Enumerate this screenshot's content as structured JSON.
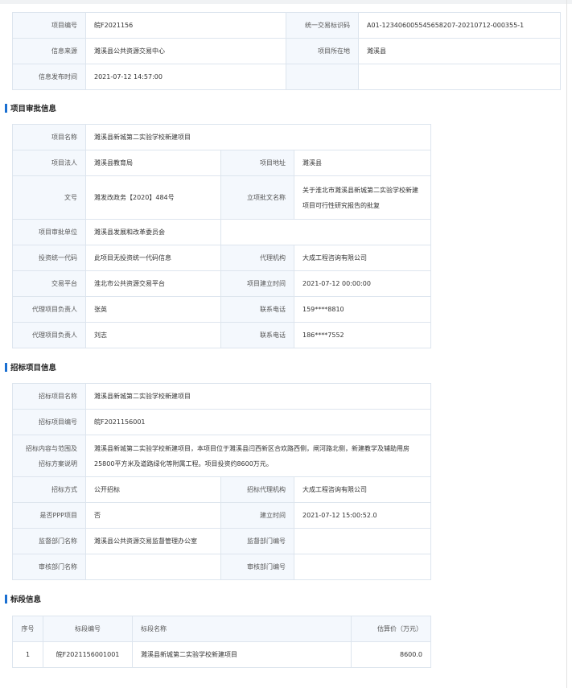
{
  "top_info": {
    "project_no_label": "项目编号",
    "project_no": "皖F2021156",
    "unified_code_label": "统一交易标识码",
    "unified_code": "A01-123406005545658207-20210712-000355-1",
    "source_label": "信息来源",
    "source": "濉溪县公共资源交易中心",
    "location_label": "项目所在地",
    "location": "濉溪县",
    "publish_time_label": "信息发布时间",
    "publish_time": "2021-07-12 14:57:00"
  },
  "approval": {
    "title": "项目审批信息",
    "name_label": "项目名称",
    "name": "濉溪县新城第二实验学校新建项目",
    "legal_label": "项目法人",
    "legal": "濉溪县教育局",
    "address_label": "项目地址",
    "address": "濉溪县",
    "doc_no_label": "文号",
    "doc_no": "濉发改政务【2020】484号",
    "doc_name_label": "立项批文名称",
    "doc_name": "关于淮北市濉溪县新城第二实验学校新建项目可行性研究报告的批复",
    "unit_label": "项目审批单位",
    "unit": "濉溪县发展和改革委员会",
    "invest_code_label": "投资统一代码",
    "invest_code": "此项目无投资统一代码信息",
    "agency_label": "代理机构",
    "agency": "大成工程咨询有限公司",
    "platform_label": "交易平台",
    "platform": "淮北市公共资源交易平台",
    "setup_time_label": "项目建立时间",
    "setup_time": "2021-07-12 00:00:00",
    "agent_lead_label": "代理项目负责人",
    "agent_lead_1": "张英",
    "phone_label": "联系电话",
    "phone_1": "159****8810",
    "agent_lead_2": "刘志",
    "phone_2": "186****7552"
  },
  "tender": {
    "title": "招标项目信息",
    "name_label": "招标项目名称",
    "name": "濉溪县新城第二实验学校新建项目",
    "no_label": "招标项目编号",
    "no": "皖F2021156001",
    "scope_label": "招标内容与范围及招标方案说明",
    "scope": "濉溪县新城第二实验学校新建项目，本项目位于濉溪县闫西新区合欢路西侧，闸河路北侧，新建教学及辅助用房25800平方米及道路绿化等附属工程。项目投资约8600万元。",
    "method_label": "招标方式",
    "method": "公开招标",
    "tender_agency_label": "招标代理机构",
    "tender_agency": "大成工程咨询有限公司",
    "ppp_label": "是否PPP项目",
    "ppp": "否",
    "created_label": "建立时间",
    "created": "2021-07-12 15:00:52.0",
    "supervisor_label": "监督部门名称",
    "supervisor": "濉溪县公共资源交易监督管理办公室",
    "supervisor_no_label": "监督部门编号",
    "supervisor_no": "",
    "reviewer_label": "审核部门名称",
    "reviewer": "",
    "reviewer_no_label": "审核部门编号",
    "reviewer_no": ""
  },
  "lots": {
    "title": "标段信息",
    "headers": [
      "序号",
      "标段编号",
      "标段名称",
      "估算价（万元）"
    ],
    "rows": [
      [
        "1",
        "皖F2021156001001",
        "濉溪县新城第二实验学校新建项目",
        "8600.0"
      ]
    ]
  }
}
